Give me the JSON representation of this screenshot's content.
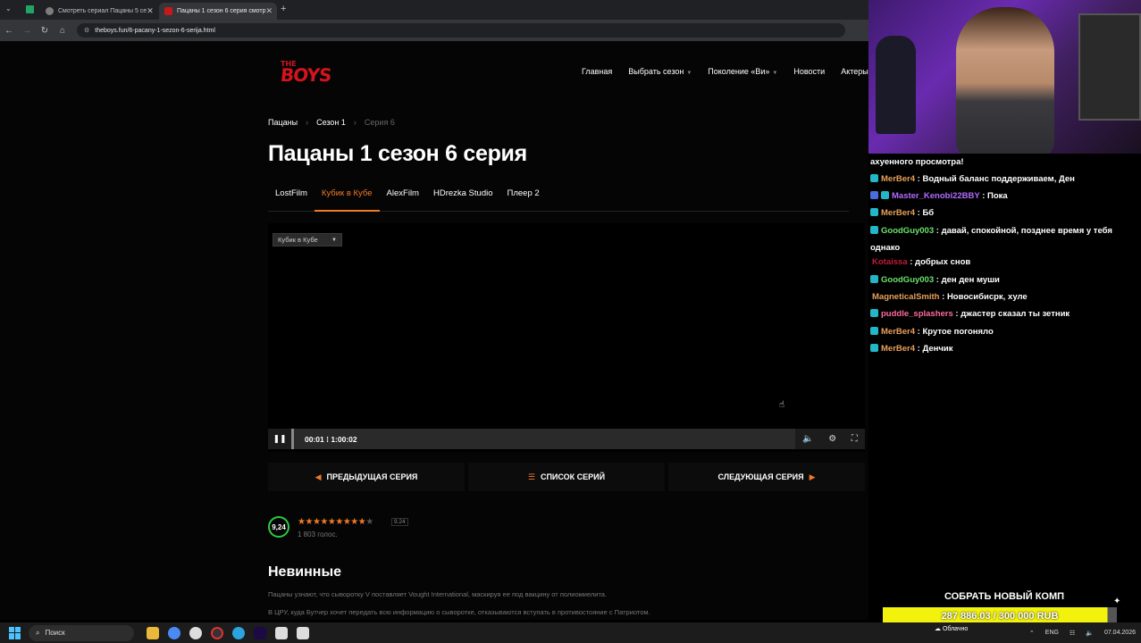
{
  "browser": {
    "tabs": [
      {
        "title": "Смотреть сериал Пацаны 5 се",
        "active": false,
        "fav_color": "#7d7d7d"
      },
      {
        "title": "Пацаны 1 сезон 6 серия смотр",
        "active": true,
        "fav_color": "#c41a1a"
      }
    ],
    "url": "theboys.fun/6-pacany-1-sezon-6-serija.html"
  },
  "site": {
    "logo_top": "THE",
    "logo_main": "BOYS",
    "nav": [
      {
        "label": "Главная",
        "caret": false
      },
      {
        "label": "Выбрать сезон",
        "caret": true
      },
      {
        "label": "Поколение «Ви»",
        "caret": true
      },
      {
        "label": "Новости",
        "caret": false
      },
      {
        "label": "Актеры",
        "caret": false
      }
    ],
    "breadcrumb": [
      "Пацаны",
      "Сезон 1",
      "Серия 6"
    ],
    "title": "Пацаны 1 сезон 6 серия",
    "voice_tabs": [
      "LostFilm",
      "Кубик в Кубе",
      "AlexFilm",
      "HDrezka Studio",
      "Плеер 2"
    ],
    "active_voice": 1,
    "player": {
      "select_value": "Кубик в Кубе",
      "current": "00:01",
      "duration": "1:00:02",
      "progress": 0.0003
    },
    "episode_nav": {
      "prev": "ПРЕДЫДУЩАЯ СЕРИЯ",
      "list": "СПИСОК СЕРИЙ",
      "next": "СЛЕДУЮЩАЯ СЕРИЯ"
    },
    "rating": {
      "value": "9,24",
      "score_small": "9.24",
      "stars_filled": 9,
      "stars_total": 10,
      "votes": "1 803 голос."
    },
    "episode_title": "Невинные",
    "description": [
      "Пацаны узнают, что сыворотку V поставляет Vought International, маскируя ее под вакцину от полиомиелита.",
      "В ЦРУ, куда Бутчер хочет передать всю информацию о сыворотке, отказываются вступать в противостояние с Патриотом."
    ],
    "colors": {
      "accent": "#f07a28",
      "logo": "#d4141c",
      "rating_ring": "#2ecc40"
    }
  },
  "stream": {
    "chat": [
      {
        "user": "",
        "text": "ахуенного просмотра!",
        "color": "#ffffff",
        "badges": 0
      },
      {
        "user": "MerBer4",
        "text": ": Водный баланс поддерживаем, Ден",
        "color": "#e8a05a",
        "badges": 1
      },
      {
        "user": "Master_Kenobi22BBY",
        "text": ": Пока",
        "color": "#b36bff",
        "badges": 2
      },
      {
        "user": "MerBer4",
        "text": ": Бб",
        "color": "#e8a05a",
        "badges": 1
      },
      {
        "user": "GoodGuy003",
        "text": ": давай, спокойной, позднее время у тебя",
        "color": "#6be36b",
        "badges": 1
      },
      {
        "user": "",
        "text": "однако",
        "color": "#ffffff",
        "badges": 0
      },
      {
        "user": "Kotaissa",
        "text": ": добрых снов",
        "color": "#c41a3a",
        "badges": 0
      },
      {
        "user": "GoodGuy003",
        "text": ": ден ден муши",
        "color": "#6be36b",
        "badges": 1
      },
      {
        "user": "MagneticalSmith",
        "text": ": Новосибисрк, хуле",
        "color": "#e8a05a",
        "badges": 0
      },
      {
        "user": "puddle_splashers",
        "text": ": джастер сказал ты зетник",
        "color": "#ff6b9a",
        "badges": 1
      },
      {
        "user": "MerBer4",
        "text": ": Крутое погоняло",
        "color": "#e8a05a",
        "badges": 1
      },
      {
        "user": "MerBer4",
        "text": ": Денчик",
        "color": "#e8a05a",
        "badges": 1
      }
    ],
    "goal_title": "СОБРАТЬ НОВЫЙ КОМП",
    "goal_value": "287 886.03 / 300 000 RUB",
    "goal_progress": 0.9596
  },
  "taskbar": {
    "search": "Поиск",
    "weather": "Облачно",
    "lang": "ENG",
    "date": "07.04.2026"
  }
}
